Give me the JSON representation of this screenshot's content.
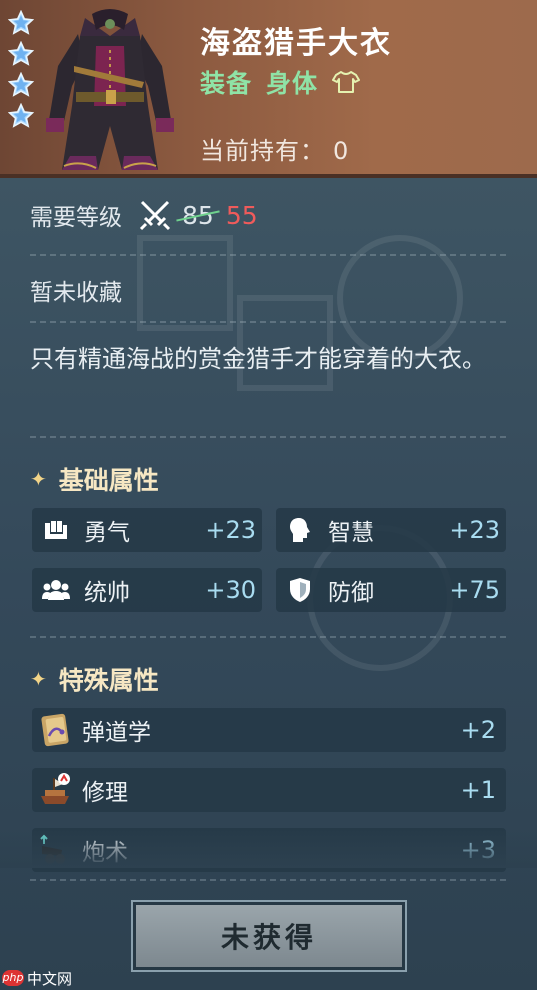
{
  "item": {
    "name": "海盗猎手大衣",
    "category": "装备",
    "slot": "身体",
    "owned_label": "当前持有：",
    "owned_value": "0",
    "stars": 4
  },
  "requirement": {
    "label": "需要等级",
    "old_level": "85",
    "new_level": "55"
  },
  "collection_status": "暂未收藏",
  "description": "只有精通海战的赏金猎手才能穿着的大衣。",
  "base_section": {
    "title": "基础属性",
    "stats": [
      {
        "label": "勇气",
        "value": "+23",
        "icon": "courage-icon"
      },
      {
        "label": "智慧",
        "value": "+23",
        "icon": "wisdom-icon"
      },
      {
        "label": "统帅",
        "value": "+30",
        "icon": "command-icon"
      },
      {
        "label": "防御",
        "value": "+75",
        "icon": "defense-icon"
      }
    ]
  },
  "special_section": {
    "title": "特殊属性",
    "skills": [
      {
        "label": "弹道学",
        "value": "+2",
        "icon": "ballistics-book-icon"
      },
      {
        "label": "修理",
        "value": "+1",
        "icon": "repair-ship-icon"
      },
      {
        "label": "炮术",
        "value": "+3",
        "icon": "cannon-icon"
      }
    ]
  },
  "action_button": "未获得",
  "watermark": "php中文网",
  "colors": {
    "header_bg": "#8c5a40",
    "type_green": "#8fe3a6",
    "level_red": "#ef5b5b",
    "value_blue": "#a9dcf0",
    "section_gold": "#f6e7c3"
  }
}
